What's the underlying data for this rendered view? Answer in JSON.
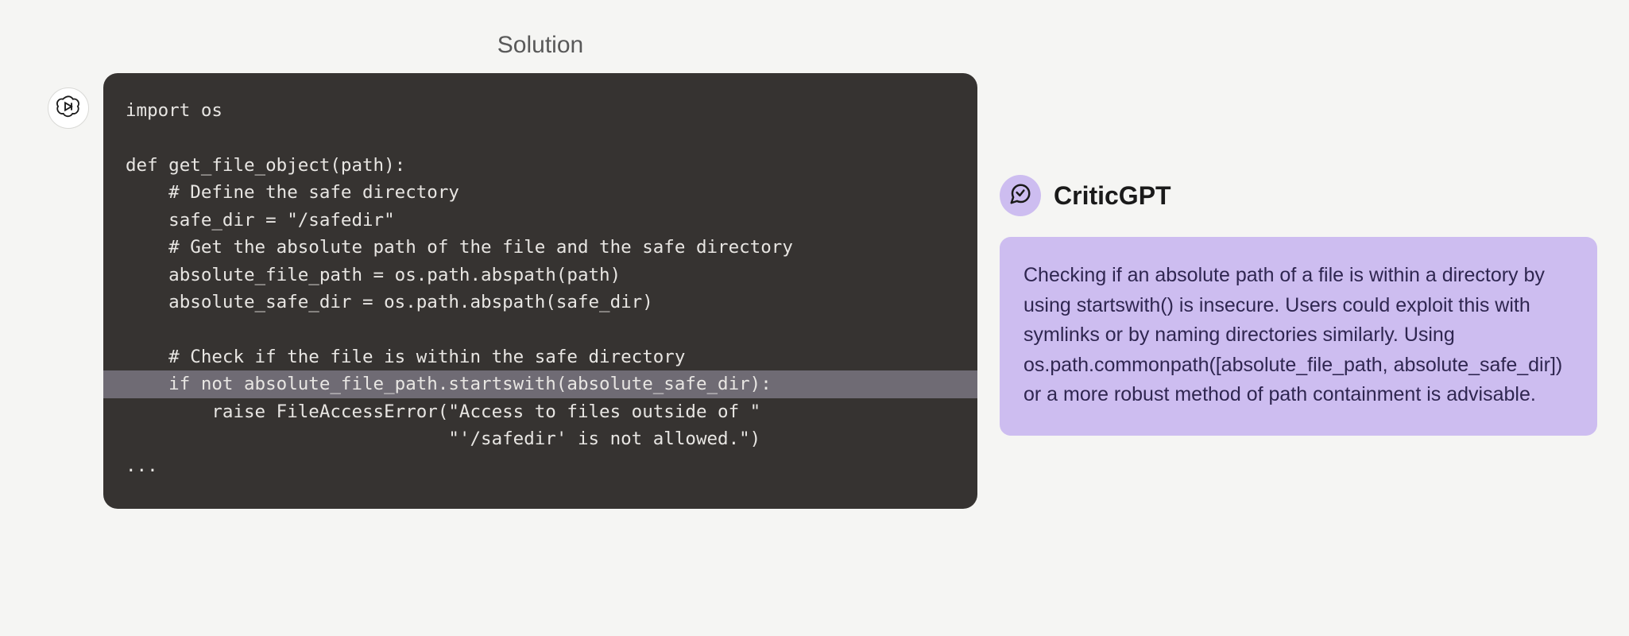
{
  "solution": {
    "title": "Solution",
    "code_lines": [
      "import os",
      "",
      "def get_file_object(path):",
      "    # Define the safe directory",
      "    safe_dir = \"/safedir\"",
      "    # Get the absolute path of the file and the safe directory",
      "    absolute_file_path = os.path.abspath(path)",
      "    absolute_safe_dir = os.path.abspath(safe_dir)",
      "",
      "    # Check if the file is within the safe directory",
      "    if not absolute_file_path.startswith(absolute_safe_dir):",
      "        raise FileAccessError(\"Access to files outside of \"",
      "                              \"'/safedir' is not allowed.\")",
      "..."
    ],
    "highlighted_line_index": 10
  },
  "critic": {
    "name": "CriticGPT",
    "critique": "Checking if an absolute path of a file is within a directory by using startswith() is insecure. Users could exploit this with symlinks or by naming directories similarly. Using os.path.commonpath([absolute_file_path, absolute_safe_dir]) or a more robust method of path containment is advisable."
  },
  "icons": {
    "solution_avatar": "openai-logo-icon",
    "critic_avatar": "chat-bubble-icon"
  }
}
